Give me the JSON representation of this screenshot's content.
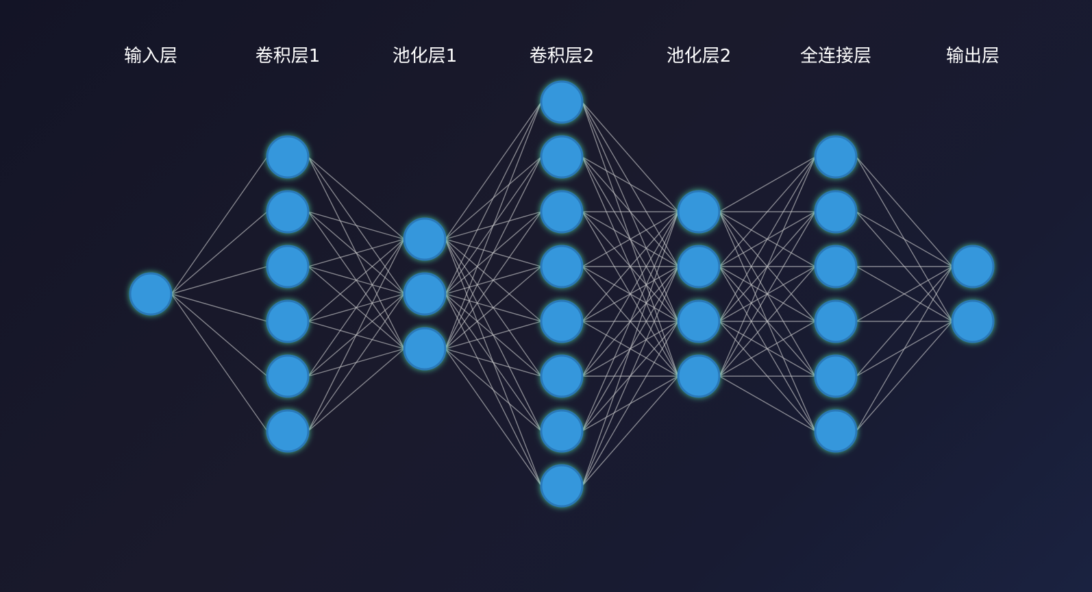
{
  "diagram": {
    "type": "neural-network",
    "colors": {
      "neuron_fill": "#3597dc",
      "neuron_stroke": "#2a78b8",
      "neuron_glow": "#4fd1a0",
      "edge": "#c9c9cc",
      "label": "#ffffff"
    },
    "layers": [
      {
        "label": "输入层",
        "neurons": 1
      },
      {
        "label": "卷积层1",
        "neurons": 6
      },
      {
        "label": "池化层1",
        "neurons": 3
      },
      {
        "label": "卷积层2",
        "neurons": 8
      },
      {
        "label": "池化层2",
        "neurons": 4
      },
      {
        "label": "全连接层",
        "neurons": 6
      },
      {
        "label": "输出层",
        "neurons": 2
      }
    ]
  }
}
